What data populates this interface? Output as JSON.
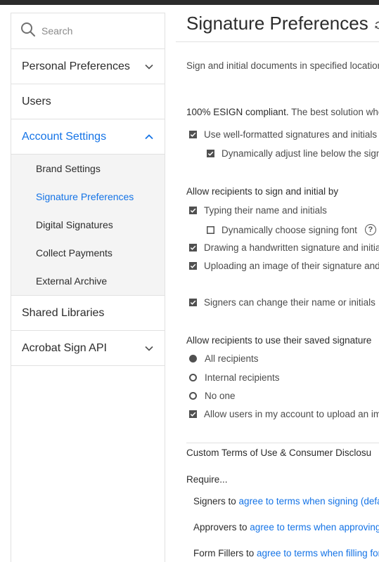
{
  "sidebar": {
    "search_placeholder": "Search",
    "items": [
      {
        "label": "Personal Preferences"
      },
      {
        "label": "Users"
      },
      {
        "label": "Account Settings"
      },
      {
        "label": "Shared Libraries"
      },
      {
        "label": "Acrobat Sign API"
      }
    ],
    "sub_items": [
      {
        "label": "Brand Settings"
      },
      {
        "label": "Signature Preferences"
      },
      {
        "label": "Digital Signatures"
      },
      {
        "label": "Collect Payments"
      },
      {
        "label": "External Archive"
      }
    ],
    "active_color": "#1473e6"
  },
  "main": {
    "title": "Signature Preferences",
    "intro": "Sign and initial documents in specified location",
    "esign_bold": "100% ESIGN compliant.",
    "esign_rest": " The best solution whe",
    "opt_well_formatted": "Use well-formatted signatures and initials",
    "opt_dynamic_line": "Dynamically adjust line below the sign",
    "allow_sign_heading": "Allow recipients to sign and initial by",
    "opt_typing": "Typing their name and initials",
    "opt_dynamic_font": "Dynamically choose signing font",
    "opt_drawing": "Drawing a handwritten signature and initial",
    "opt_uploading": "Uploading an image of their signature and i",
    "opt_change_name": "Signers can change their name or initials",
    "saved_sig_heading": "Allow recipients to use their saved signature",
    "radio_all": "All recipients",
    "radio_internal": "Internal recipients",
    "radio_none": "No one",
    "opt_allow_upload": "Allow users in my account to upload an im",
    "custom_terms_heading": "Custom Terms of Use & Consumer Disclosu",
    "require_label": "Require...",
    "signers_prefix": "Signers to ",
    "signers_link": "agree to terms when signing (defa",
    "approvers_prefix": "Approvers to ",
    "approvers_link": "agree to terms when approving",
    "fillers_prefix": "Form Fillers to ",
    "fillers_link": "agree to terms when filling for"
  }
}
